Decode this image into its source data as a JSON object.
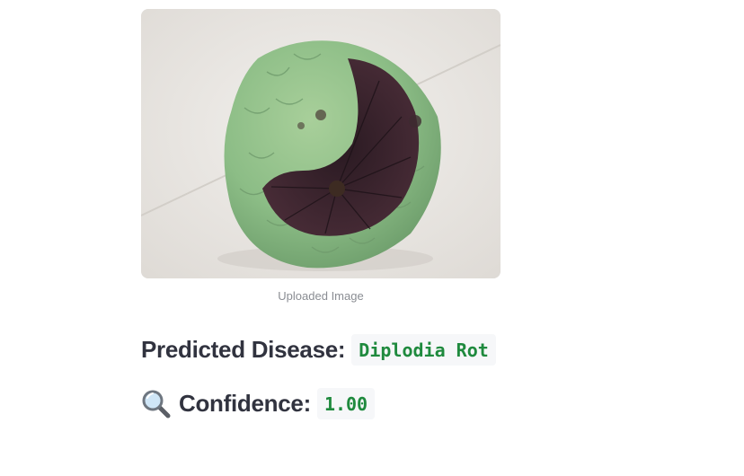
{
  "image": {
    "alt": "Custard apple fruit with dark diseased patch",
    "caption": "Uploaded Image"
  },
  "prediction": {
    "disease_label": "Predicted Disease:",
    "disease_value": "Diplodia Rot",
    "confidence_icon": "magnifying-glass-icon",
    "confidence_label": "Confidence:",
    "confidence_value": "1.00"
  },
  "colors": {
    "text": "#31333f",
    "code_text": "#1f8a3e",
    "code_bg": "#f6f7f9",
    "caption": "#8a8d93"
  }
}
